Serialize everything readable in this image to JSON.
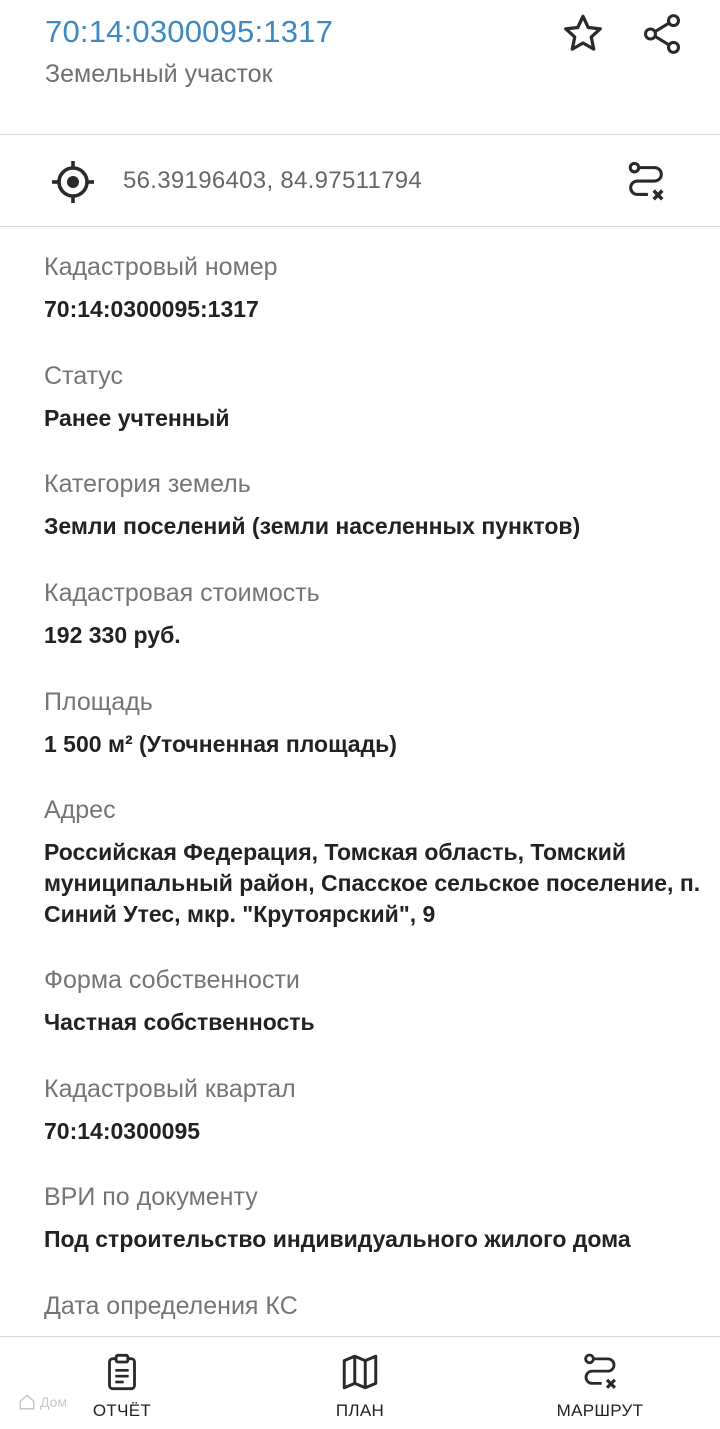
{
  "header": {
    "title": "70:14:0300095:1317",
    "subtitle": "Земельный участок",
    "favorite_icon": "star-icon",
    "share_icon": "share-icon",
    "title_color": "#3d89c2"
  },
  "coordinates": {
    "text": "56.39196403, 84.97511794",
    "locate_icon": "crosshair-icon",
    "route_icon": "route-icon"
  },
  "fields": [
    {
      "label": "Кадастровый номер",
      "value": "70:14:0300095:1317"
    },
    {
      "label": "Статус",
      "value": "Ранее учтенный"
    },
    {
      "label": "Категория земель",
      "value": "Земли поселений (земли населенных пунктов)"
    },
    {
      "label": "Кадастровая стоимость",
      "value": "192 330 руб."
    },
    {
      "label": "Площадь",
      "value": "1 500 м² (Уточненная площадь)"
    },
    {
      "label": "Адрес",
      "value": "Российская Федерация, Томская область, Томский муниципальный район, Спасское сельское поселение, п. Синий Утес, мкр. \"Крутоярский\", 9"
    },
    {
      "label": "Форма собственности",
      "value": "Частная собственность"
    },
    {
      "label": "Кадастровый квартал",
      "value": "70:14:0300095"
    },
    {
      "label": "ВРИ по документу",
      "value": "Под строительство индивидуального жилого дома"
    },
    {
      "label": "Дата определения КС",
      "value": ""
    }
  ],
  "bottom_nav": {
    "report": {
      "label": "ОТЧЁТ",
      "icon": "clipboard-icon"
    },
    "plan": {
      "label": "ПЛАН",
      "icon": "map-icon"
    },
    "route": {
      "label": "МАРШРУТ",
      "icon": "route-icon"
    }
  },
  "watermark": "Дом"
}
